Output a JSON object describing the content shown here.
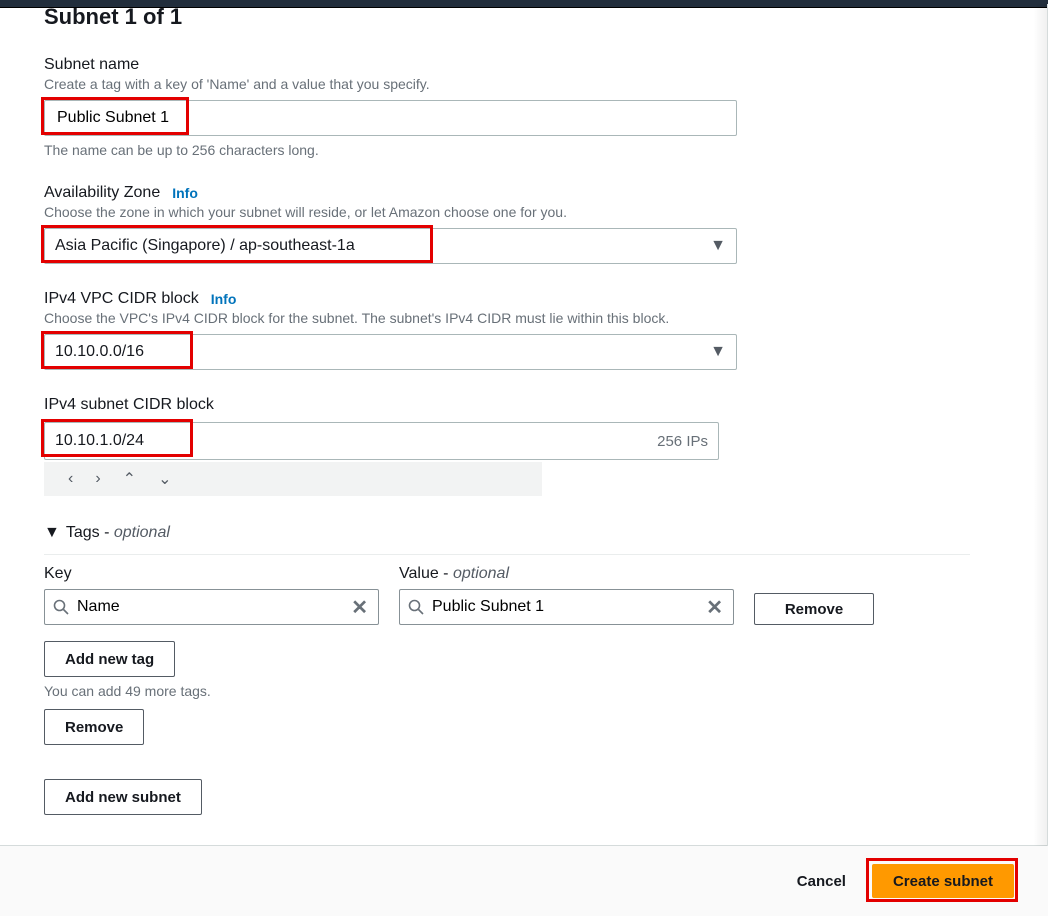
{
  "card": {
    "title": "Subnet 1 of 1"
  },
  "subnet_name": {
    "label": "Subnet name",
    "desc": "Create a tag with a key of 'Name' and a value that you specify.",
    "value": "Public Subnet 1",
    "hint": "The name can be up to 256 characters long."
  },
  "az": {
    "label": "Availability Zone",
    "info": "Info",
    "desc": "Choose the zone in which your subnet will reside, or let Amazon choose one for you.",
    "value": "Asia Pacific (Singapore) / ap-southeast-1a"
  },
  "vpc_cidr": {
    "label": "IPv4 VPC CIDR block",
    "info": "Info",
    "desc": "Choose the VPC's IPv4 CIDR block for the subnet. The subnet's IPv4 CIDR must lie within this block.",
    "value": "10.10.0.0/16"
  },
  "subnet_cidr": {
    "label": "IPv4 subnet CIDR block",
    "value": "10.10.1.0/24",
    "ip_count": "256 IPs"
  },
  "tags": {
    "header_prefix": "Tags - ",
    "header_suffix": "optional",
    "key_label": "Key",
    "value_label": "Value - ",
    "value_optional": "optional",
    "key_value": "Name",
    "value_value": "Public Subnet 1",
    "remove_label": "Remove",
    "add_label": "Add new tag",
    "count_hint": "You can add 49 more tags."
  },
  "subnet_actions": {
    "remove": "Remove",
    "add": "Add new subnet"
  },
  "footer": {
    "cancel": "Cancel",
    "create": "Create subnet"
  }
}
